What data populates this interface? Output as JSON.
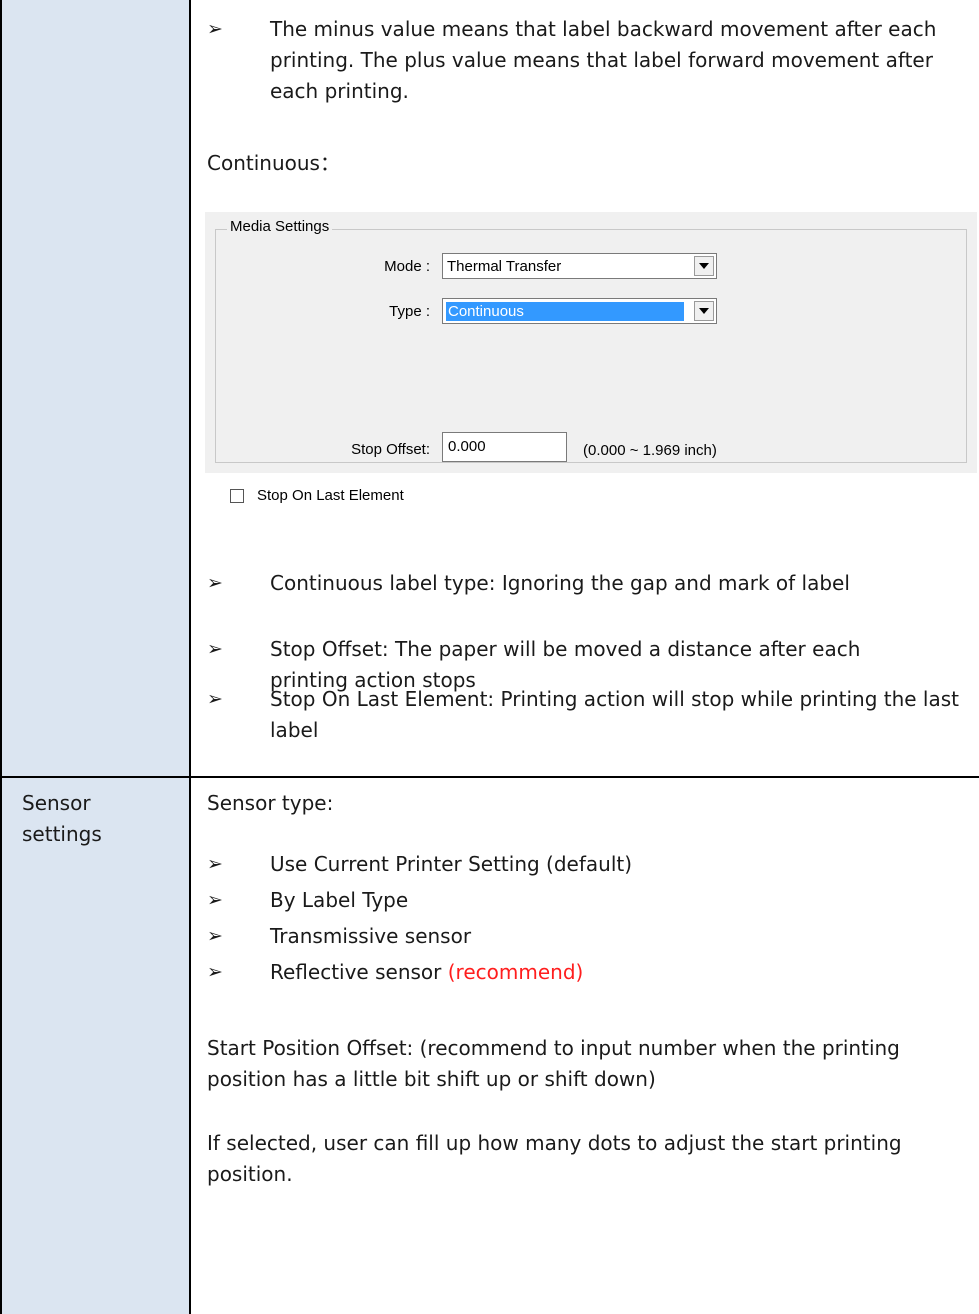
{
  "top_bullets": [
    {
      "glyph": "➢",
      "text": "The minus value means that label backward movement after each printing. The plus value means that label forward movement after each printing."
    }
  ],
  "continuous_heading": "Continuous：",
  "media_settings": {
    "title": "Media Settings",
    "mode_label": "Mode :",
    "mode_value": "Thermal Transfer",
    "type_label": "Type :",
    "type_value": "Continuous",
    "stop_offset_label": "Stop Offset:",
    "stop_offset_value": "0.000",
    "stop_offset_range": "(0.000 ~ 1.969 inch)",
    "stop_on_last_label": "Stop On Last Element",
    "stop_on_last_checked": false
  },
  "continuous_bullets": [
    {
      "glyph": "➢",
      "text": "Continuous label type: Ignoring the gap and mark of label"
    },
    {
      "glyph": "➢",
      "text": "Stop Offset: The paper will be moved a distance after each printing action stops"
    },
    {
      "glyph": "➢",
      "text": "Stop On Last Element: Printing action will stop while printing the last label"
    }
  ],
  "sensor_row": {
    "left_label": "Sensor settings",
    "sensor_type_heading": "Sensor type:",
    "options": [
      {
        "glyph": "➢",
        "text": "Use Current Printer Setting (default)"
      },
      {
        "glyph": "➢",
        "text": "By Label Type"
      },
      {
        "glyph": "➢",
        "text": "Transmissive sensor"
      },
      {
        "glyph": "➢",
        "text": "Reflective sensor",
        "note": "(recommend)",
        "note_color": "#ff1e1e"
      }
    ],
    "start_offset_text": "Start Position Offset: (recommend to input number when the printing position has a little bit shift up or shift down)",
    "if_selected_text": "If selected, user can fill up how many dots to adjust the start printing position."
  }
}
